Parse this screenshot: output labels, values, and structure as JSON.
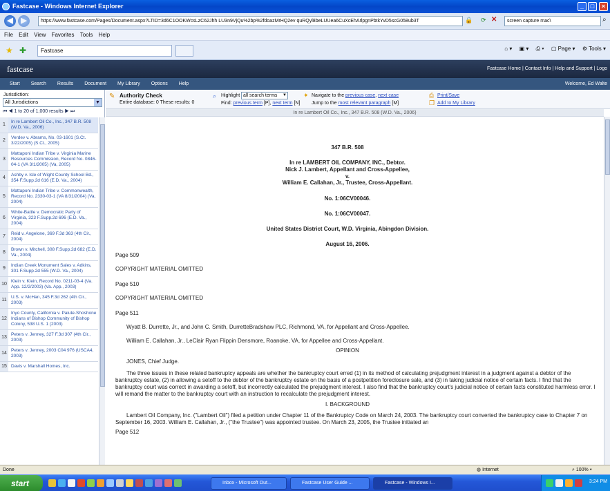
{
  "window": {
    "title": "Fastcase - Windows Internet Explorer"
  },
  "address": {
    "url": "https://www.fastcase.com/Pages/Document.aspx?LTID=3d6C1OOKWcsLzC62Jhh LU3n9VjQu%2bp%2fdoazMrHQ2ev quRQyl8beLUUea6CuXcEhArlpgnPbtkYvD5scG058ub3T",
    "search_value": "screen capture mac\\"
  },
  "menu": [
    "File",
    "Edit",
    "View",
    "Favorites",
    "Tools",
    "Help"
  ],
  "tabs": {
    "active": "Fastcase"
  },
  "ie_toolbar": {
    "page": "Page",
    "tools": "Tools"
  },
  "fastcase": {
    "logo": "fastcase",
    "header_links": "Fastcase Home | Contact Info | Help and Support | Logo",
    "nav": [
      "Start",
      "Search",
      "Results",
      "Document",
      "My Library",
      "Options",
      "Help"
    ],
    "welcome": "Welcome, Ed Walte"
  },
  "left": {
    "jurisdiction_label": "Jurisdiction:",
    "jurisdiction_value": "All Jurisdictions",
    "pager": "1 to 20 of 1,000 results",
    "results": [
      {
        "num": "1",
        "text": "In re Lambert Oil Co., Inc., 347 B.R. 508 (W.D. Va., 2006)"
      },
      {
        "num": "2",
        "text": "Verdev v. Abrams, No. 03-1601 (S.Ct. 3/22/2005) (S.Ct., 2005)"
      },
      {
        "num": "3",
        "text": "Mattaponi Indian Tribe v. Virginia Marine Resources Commission, Record No. 0846-04-1 (VA 3/1/2005) (Va, 2005)"
      },
      {
        "num": "4",
        "text": "Ashby v. Isle of Wight County School Bd., 354 F.Supp.2d 616 (E.D. Va., 2004)"
      },
      {
        "num": "5",
        "text": "Mattaponi Indian Tribe v. Commonwealth, Record No. 2330-03-1 (VA 8/31/2004) (Va, 2004)"
      },
      {
        "num": "6",
        "text": "White-Battle v. Democratic Party of Virginia, 323 F.Supp.2d 696 (E.D. Va., 2004)"
      },
      {
        "num": "7",
        "text": "Reid v. Angelone, 369 F.3d 363 (4th Cir., 2004)"
      },
      {
        "num": "8",
        "text": "Brown v. Mitchell, 308 F.Supp.2d 682 (E.D. Va., 2004)"
      },
      {
        "num": "9",
        "text": "Indian Creek Monument Sales v. Adkins, 301 F.Supp.2d 555 (W.D. Va., 2004)"
      },
      {
        "num": "10",
        "text": "Klein v. Klein, Record No. 0211-03-4 (Va. App. 12/2/2003) (Va. App., 2003)"
      },
      {
        "num": "11",
        "text": "U.S. v. McHan, 345 F.3d 262 (4th Cir., 2003)"
      },
      {
        "num": "12",
        "text": "Inyo County, California v. Paiute-Shoshone Indians of Bishop Community of Bishop Colony, 538 U.S. 1 (2003)"
      },
      {
        "num": "13",
        "text": "Peters v. Jenney, 327 F.3d 307 (4th Cir., 2003)"
      },
      {
        "num": "14",
        "text": "Peters v. Jenney, 2003 C04 976 (USCA4, 2003)"
      },
      {
        "num": "15",
        "text": "Davis v. Marshall Homes, Inc."
      }
    ]
  },
  "toolbar": {
    "authority_title": "Authority Check",
    "authority_sub": "Entire database: 0 These results: 0",
    "highlight_label": "Highlight",
    "highlight_value": "all search terms",
    "find_label": "Find:",
    "prev_term": "previous term",
    "prev_term_key": "[P],",
    "next_term": "next term",
    "next_term_key": "[N]",
    "navigate_label": "Navigate to the",
    "prev_case": "previous case",
    "next_case": "next case",
    "jump_label": "Jump to the",
    "most_relevant": "most relevant paragraph",
    "jump_key": "[M]",
    "print_save": "Print/Save",
    "add_library": "Add to My Library"
  },
  "citation_bar": "In re Lambert Oil Co., Inc., 347 B.R. 508 (W.D. Va., 2006)",
  "document": {
    "reporter": "347 B.R. 508",
    "caption1": "In re LAMBERT OIL COMPANY, INC., Debtor.",
    "caption2": "Nick J. Lambert, Appellant and Cross-Appellee,",
    "caption_v": "v.",
    "caption3": "William E. Callahan, Jr., Trustee, Cross-Appellant.",
    "docket1": "No. 1:06CV00046.",
    "docket2": "No. 1:06CV00047.",
    "court": "United States District Court, W.D. Virginia, Abingdon Division.",
    "date": "August 16, 2006.",
    "page509": "Page 509",
    "copyright1": "COPYRIGHT MATERIAL OMITTED",
    "page510": "Page 510",
    "copyright2": "COPYRIGHT MATERIAL OMITTED",
    "page511": "Page 511",
    "counsel1": "Wyatt B. Durrette, Jr., and John C. Smith, DurretteBradshaw PLC, Richmond, VA, for Appellant and Cross-Appellee.",
    "counsel2": "William E. Callahan, Jr., LeClair Ryan Flippin Densmore, Roanoke, VA, for Appellee and Cross-Appellant.",
    "opinion": "OPINION",
    "judge": "JONES, Chief Judge.",
    "para1": "The three issues in these related bankruptcy appeals are whether the bankruptcy court erred (1) in its method of calculating prejudgment interest in a judgment against a debtor of the bankruptcy estate, (2) in allowing a setoff to the debtor of the bankruptcy estate on the basis of a postpetition foreclosure sale, and (3) in taking judicial notice of certain facts. I find that the bankruptcy court was correct in awarding a setoff, but incorrectly calculated the prejudgment interest. I also find that the bankruptcy court's judicial notice of certain facts constituted harmless error. I will remand the matter to the bankruptcy court with an instruction to recalculate the prejudgment interest.",
    "section": "I. BACKGROUND",
    "para2": "Lambert Oil Company, Inc. (\"Lambert Oil\") filed a petition under Chapter 11 of the Bankruptcy Code on March 24, 2003. The bankruptcy court converted the bankruptcy case to Chapter 7 on September 16, 2003. William E. Callahan, Jr., (\"the Trustee\") was appointed trustee. On March 23, 2005, the Trustee initiated an",
    "page512": "Page 512"
  },
  "status": {
    "left": "Done",
    "zone": "Internet",
    "zoom": "100%"
  },
  "taskbar": {
    "start": "start",
    "buttons": [
      "Inbox - Microsoft Out...",
      "Fastcase User Guide ...",
      "Fastcase - Windows I..."
    ],
    "clock": "3:24 PM"
  },
  "colors": {
    "accent": "#2a4cc0",
    "header": "#1b2840",
    "nav": "#35567f"
  }
}
